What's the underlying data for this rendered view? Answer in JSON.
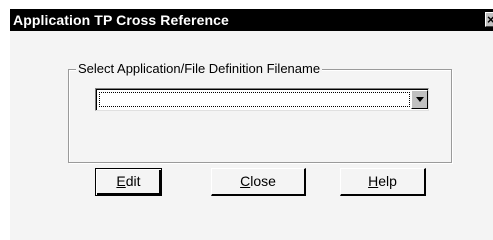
{
  "window": {
    "title": "Application TP Cross Reference",
    "close_glyph": "×",
    "close_icon": "close-icon"
  },
  "group": {
    "label": "Select Application/File Definition Filename"
  },
  "combo": {
    "value": "",
    "arrow_icon": "chevron-down-icon"
  },
  "buttons": {
    "edit": {
      "mnemonic": "E",
      "rest": "dit"
    },
    "close": {
      "mnemonic": "C",
      "rest": "lose"
    },
    "help": {
      "mnemonic": "H",
      "rest": "elp"
    }
  },
  "colors": {
    "titlebar": "#000000",
    "face": "#f4f4f4"
  }
}
